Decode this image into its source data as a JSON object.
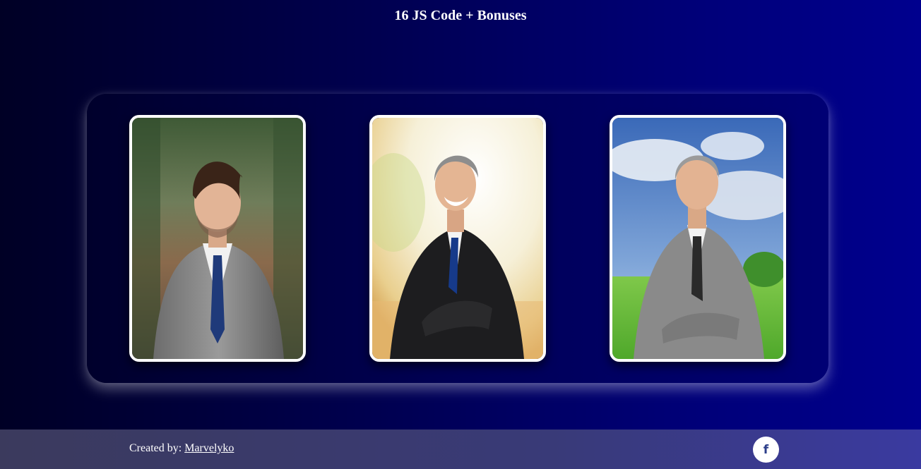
{
  "header": {
    "title": "16 JS Code + Bonuses"
  },
  "cards": [
    {
      "name": "portrait-card-1",
      "photo_alt": "Man in grey suit with blue tie, tree-lined path background"
    },
    {
      "name": "portrait-card-2",
      "photo_alt": "Grey-haired man in black suit, bright blurred background"
    },
    {
      "name": "portrait-card-3",
      "photo_alt": "Grey-haired man in grey suit, sky and grass background"
    }
  ],
  "footer": {
    "credit_prefix": "Created by: ",
    "author_link": "Marvelyko",
    "social_icon": "facebook-icon",
    "social_glyph": "f"
  },
  "colors": {
    "background_left": "#000025",
    "background_right": "#00008e",
    "card_border": "#ffffff",
    "footer": "#393a78"
  }
}
